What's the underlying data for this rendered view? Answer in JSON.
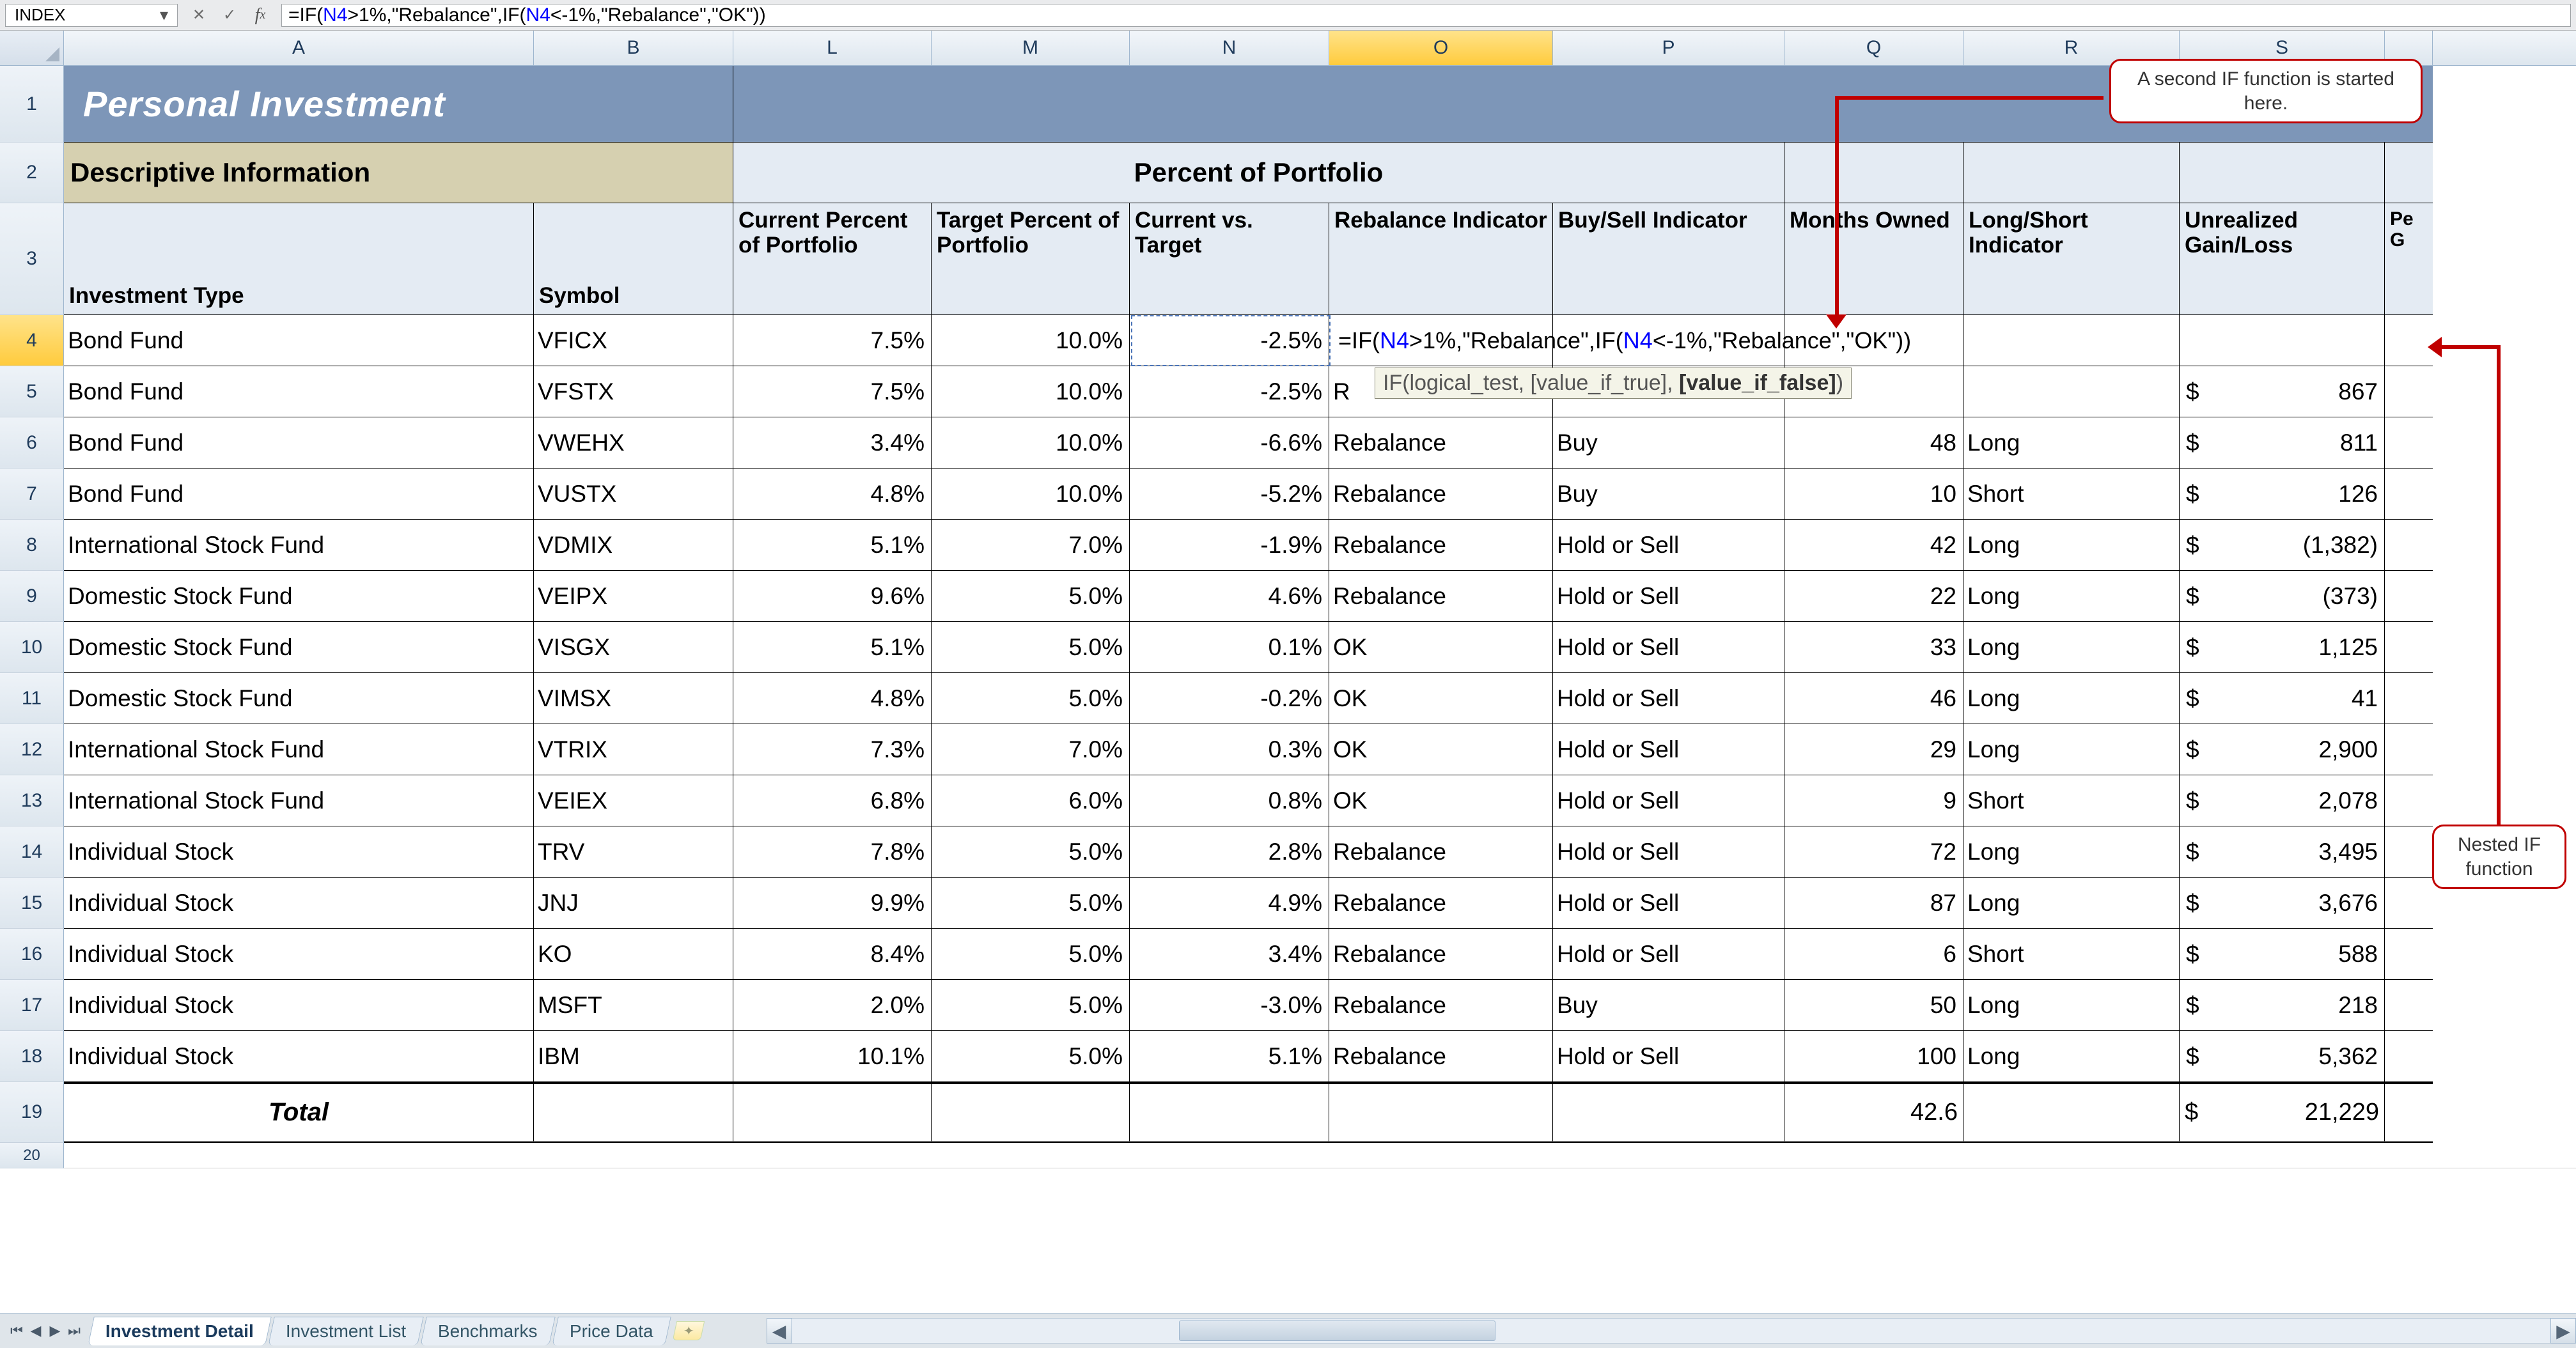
{
  "name_box": "INDEX",
  "formula_bar": {
    "prefix1": "=IF(",
    "ref1": "N4",
    "mid1": ">1%,\"Rebalance\",IF(",
    "ref2": "N4",
    "mid2": "<-1%,\"Rebalance\",\"OK\"))"
  },
  "col_letters": [
    "A",
    "B",
    "L",
    "M",
    "N",
    "O",
    "P",
    "Q",
    "R",
    "S"
  ],
  "selected_col": "O",
  "row_numbers": [
    "1",
    "2",
    "3",
    "4",
    "5",
    "6",
    "7",
    "8",
    "9",
    "10",
    "11",
    "12",
    "13",
    "14",
    "15",
    "16",
    "17",
    "18",
    "19",
    "20"
  ],
  "selected_row": "4",
  "title": "Personal Investment",
  "section_left": "Descriptive Information",
  "section_right": "Percent of Portfolio",
  "headers": {
    "A": "Investment Type",
    "B": "Symbol",
    "L": "Current Percent of Portfolio",
    "M": "Target Percent of Portfolio",
    "N": "Current vs. Target",
    "O": "Rebalance Indicator",
    "P": "Buy/Sell Indicator",
    "Q": "Months Owned",
    "R": "Long/Short Indicator",
    "S": "Unrealized Gain/Loss",
    "T": "Pe G"
  },
  "rows": [
    {
      "type": "Bond Fund",
      "sym": "VFICX",
      "l": "7.5%",
      "m": "10.0%",
      "n": "-2.5%",
      "o": "",
      "p": "",
      "q": "",
      "r": "",
      "s": ""
    },
    {
      "type": "Bond Fund",
      "sym": "VFSTX",
      "l": "7.5%",
      "m": "10.0%",
      "n": "-2.5%",
      "o": "R",
      "p": "",
      "q": "",
      "r": "",
      "s": "867"
    },
    {
      "type": "Bond Fund",
      "sym": "VWEHX",
      "l": "3.4%",
      "m": "10.0%",
      "n": "-6.6%",
      "o": "Rebalance",
      "p": "Buy",
      "q": "48",
      "r": "Long",
      "s": "811"
    },
    {
      "type": "Bond Fund",
      "sym": "VUSTX",
      "l": "4.8%",
      "m": "10.0%",
      "n": "-5.2%",
      "o": "Rebalance",
      "p": "Buy",
      "q": "10",
      "r": "Short",
      "s": "126"
    },
    {
      "type": "International Stock Fund",
      "sym": "VDMIX",
      "l": "5.1%",
      "m": "7.0%",
      "n": "-1.9%",
      "o": "Rebalance",
      "p": "Hold or Sell",
      "q": "42",
      "r": "Long",
      "s": "(1,382)"
    },
    {
      "type": "Domestic Stock Fund",
      "sym": "VEIPX",
      "l": "9.6%",
      "m": "5.0%",
      "n": "4.6%",
      "o": "Rebalance",
      "p": "Hold or Sell",
      "q": "22",
      "r": "Long",
      "s": "(373)"
    },
    {
      "type": "Domestic Stock Fund",
      "sym": "VISGX",
      "l": "5.1%",
      "m": "5.0%",
      "n": "0.1%",
      "o": "OK",
      "p": "Hold or Sell",
      "q": "33",
      "r": "Long",
      "s": "1,125"
    },
    {
      "type": "Domestic Stock Fund",
      "sym": "VIMSX",
      "l": "4.8%",
      "m": "5.0%",
      "n": "-0.2%",
      "o": "OK",
      "p": "Hold or Sell",
      "q": "46",
      "r": "Long",
      "s": "41"
    },
    {
      "type": "International Stock Fund",
      "sym": "VTRIX",
      "l": "7.3%",
      "m": "7.0%",
      "n": "0.3%",
      "o": "OK",
      "p": "Hold or Sell",
      "q": "29",
      "r": "Long",
      "s": "2,900"
    },
    {
      "type": "International Stock Fund",
      "sym": "VEIEX",
      "l": "6.8%",
      "m": "6.0%",
      "n": "0.8%",
      "o": "OK",
      "p": "Hold or Sell",
      "q": "9",
      "r": "Short",
      "s": "2,078"
    },
    {
      "type": "Individual Stock",
      "sym": "TRV",
      "l": "7.8%",
      "m": "5.0%",
      "n": "2.8%",
      "o": "Rebalance",
      "p": "Hold or Sell",
      "q": "72",
      "r": "Long",
      "s": "3,495"
    },
    {
      "type": "Individual Stock",
      "sym": "JNJ",
      "l": "9.9%",
      "m": "5.0%",
      "n": "4.9%",
      "o": "Rebalance",
      "p": "Hold or Sell",
      "q": "87",
      "r": "Long",
      "s": "3,676"
    },
    {
      "type": "Individual Stock",
      "sym": "KO",
      "l": "8.4%",
      "m": "5.0%",
      "n": "3.4%",
      "o": "Rebalance",
      "p": "Hold or Sell",
      "q": "6",
      "r": "Short",
      "s": "588"
    },
    {
      "type": "Individual Stock",
      "sym": "MSFT",
      "l": "2.0%",
      "m": "5.0%",
      "n": "-3.0%",
      "o": "Rebalance",
      "p": "Buy",
      "q": "50",
      "r": "Long",
      "s": "218"
    },
    {
      "type": "Individual Stock",
      "sym": "IBM",
      "l": "10.1%",
      "m": "5.0%",
      "n": "5.1%",
      "o": "Rebalance",
      "p": "Hold or Sell",
      "q": "100",
      "r": "Long",
      "s": "5,362"
    }
  ],
  "total_label": "Total",
  "total_q": "42.6",
  "total_s": "21,229",
  "tooltip": {
    "pre": "IF(logical_test, [value_if_true], ",
    "bold": "[value_if_false]",
    "post": ")"
  },
  "callouts": {
    "top": "A second IF function is started here.",
    "right": "Nested IF function"
  },
  "tabs": [
    "Investment Detail",
    "Investment List",
    "Benchmarks",
    "Price Data"
  ],
  "active_tab": 0
}
